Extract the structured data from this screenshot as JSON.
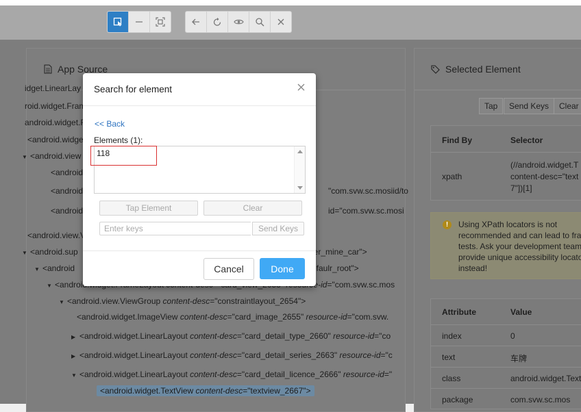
{
  "toolbar": {
    "group1": [
      "select-icon",
      "swipe-icon",
      "tap-area-icon"
    ],
    "group2": [
      "back-icon",
      "refresh-icon",
      "eye-icon",
      "search-icon",
      "close-icon"
    ]
  },
  "app_source": {
    "title": "App Source",
    "icon": "file-icon",
    "lines": [
      {
        "t": "idget.LinearLay"
      },
      {
        "t": "roid.widget.Frame"
      },
      {
        "t": "android.widget.Fra"
      },
      {
        "t": "<android.widget"
      },
      {
        "t": "<android.view"
      },
      {
        "t": "<android"
      },
      {
        "t": "<android",
        "tail": "\"com.svw.sc.mosiid/to"
      },
      {
        "t": "<android",
        "tail": "id=\"com.svw.sc.mosi"
      },
      {
        "t": "<android.view.V"
      },
      {
        "t": "<android.sup",
        "tail": "cycler_mine_car\">"
      },
      {
        "t": "<android",
        "tail": "efaulr_root\">"
      },
      {
        "t": "<android.widget.FrameLayout",
        "attr1": "content-desc",
        "v1": "=\"card_view_2653\" ",
        "attr2": "resource-id",
        "v2": "=\"com.svw.sc.mos"
      },
      {
        "t": "<android.view.ViewGroup",
        "attr1": "content-desc",
        "v1": "=\"constraintlayout_2654\">"
      },
      {
        "t": "<android.widget.ImageView",
        "attr1": "content-desc",
        "v1": "=\"card_image_2655\" ",
        "attr2": "resource-id",
        "v2": "=\"com.svw."
      },
      {
        "t": "<android.widget.LinearLayout",
        "attr1": "content-desc",
        "v1": "=\"card_detail_type_2660\" ",
        "attr2": "resource-id",
        "v2": "=\"co"
      },
      {
        "t": "<android.widget.LinearLayout",
        "attr1": "content-desc",
        "v1": "=\"card_detail_series_2663\" ",
        "attr2": "resource-id",
        "v2": "=\"c"
      },
      {
        "t": "<android.widget.LinearLayout",
        "attr1": "content-desc",
        "v1": "=\"card_detail_licence_2666\" ",
        "attr2": "resource-id",
        "v2": "=\""
      },
      {
        "t": "<android.widget.TextView",
        "attr1": "content-desc",
        "v1": "=\"textview_2667\">"
      }
    ]
  },
  "selected_element": {
    "title": "Selected Element",
    "icon": "tag-icon",
    "buttons": [
      "Tap",
      "Send Keys",
      "Clear"
    ],
    "find_by_header": [
      "Find By",
      "Selector"
    ],
    "find_by_row": {
      "strategy": "xpath",
      "selector_lines": [
        "(//android.widget.T",
        "content-desc=\"text",
        "7\"])[1]"
      ]
    },
    "warning_lines": [
      "Using XPath locators is not",
      "recommended and can lead to fra",
      "tests. Ask your development team",
      "provide unique accessibility locato",
      "instead!"
    ],
    "attr_header": [
      "Attribute",
      "Value"
    ],
    "attr_rows": [
      {
        "name": "index",
        "value": "0"
      },
      {
        "name": "text",
        "value": "车牌"
      },
      {
        "name": "class",
        "value": "android.widget.Text"
      },
      {
        "name": "package",
        "value": "com.svw.sc.mos"
      }
    ]
  },
  "modal": {
    "title": "Search for element",
    "back": "<< Back",
    "elements_label": "Elements (1):",
    "elements": [
      "118"
    ],
    "tap_element": "Tap Element",
    "clear": "Clear",
    "keys_placeholder": "Enter keys",
    "send_keys": "Send Keys",
    "cancel": "Cancel",
    "done": "Done"
  },
  "colors": {
    "accent": "#40a9f5",
    "link": "#2f74c0",
    "highlight": "#d93030"
  }
}
